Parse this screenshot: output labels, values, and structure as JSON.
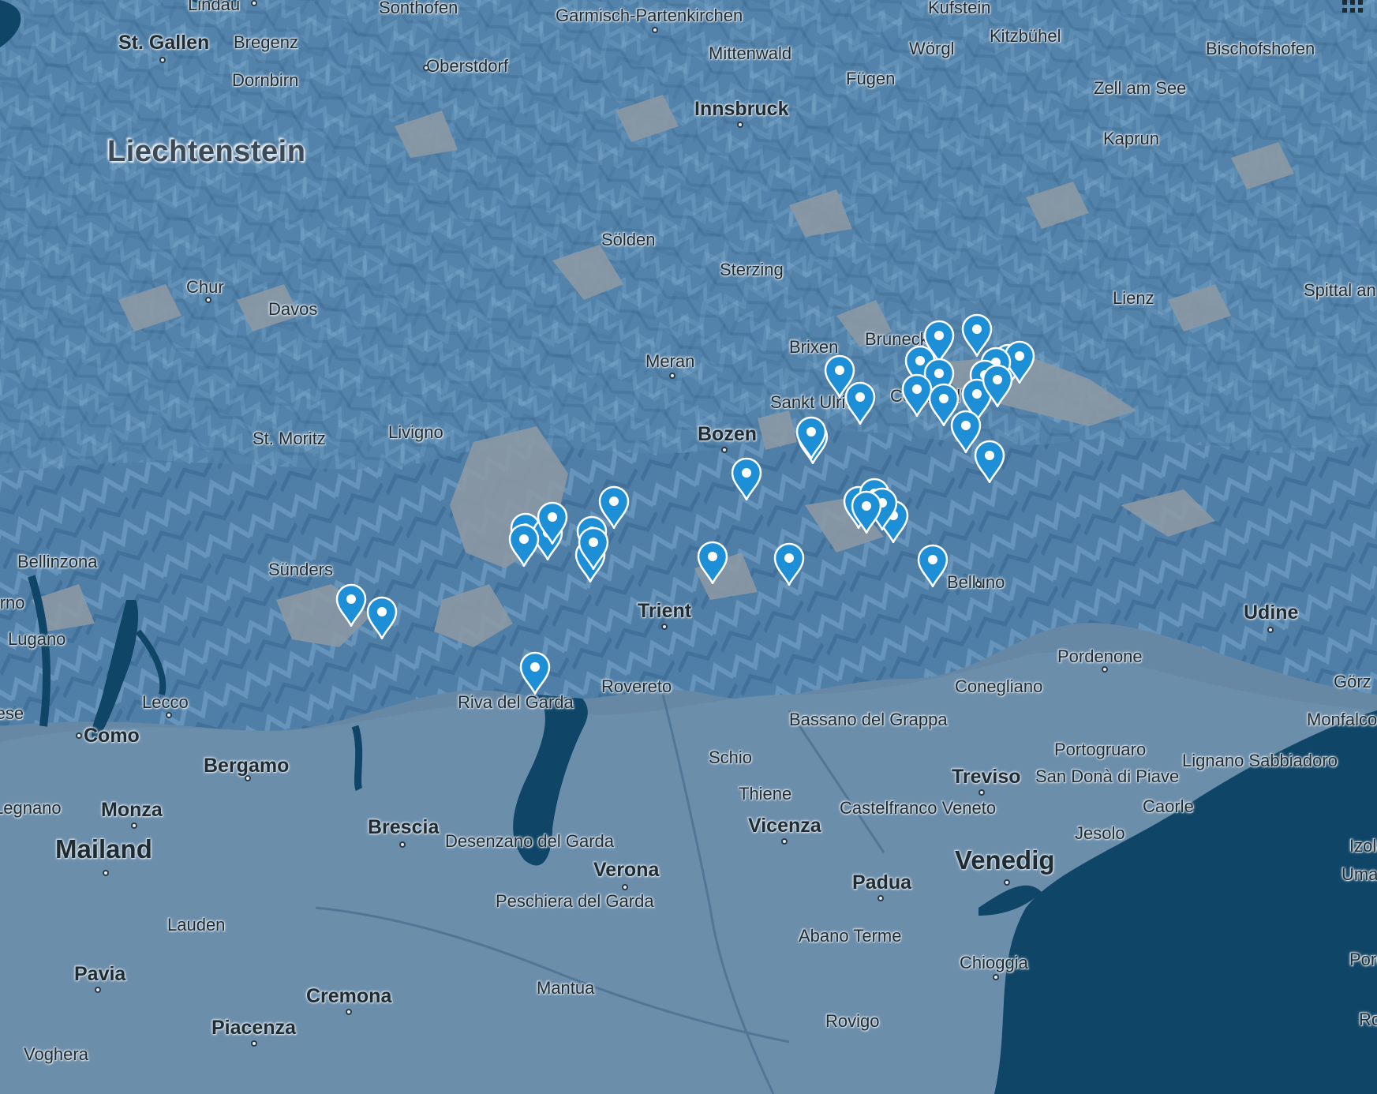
{
  "map": {
    "colors": {
      "land": "#5b82a0",
      "mountains": "#4d7ca3",
      "lowland": "#6d8fab",
      "rock": "#8e9aa5",
      "water": "#0f4566",
      "pin": "#1d8fd6"
    },
    "places": [
      {
        "name": "Lindau",
        "style": "normal"
      },
      {
        "name": "Sonthofen",
        "style": "normal"
      },
      {
        "name": "Garmisch-Partenkirchen",
        "style": "normal"
      },
      {
        "name": "Kufstein",
        "style": "normal"
      },
      {
        "name": "St. Gallen",
        "style": "big"
      },
      {
        "name": "Bregenz",
        "style": "normal"
      },
      {
        "name": "Oberstdorf",
        "style": "normal"
      },
      {
        "name": "Mittenwald",
        "style": "normal"
      },
      {
        "name": "Wörgl",
        "style": "normal"
      },
      {
        "name": "Kitzbühel",
        "style": "normal"
      },
      {
        "name": "Bischofshofen",
        "style": "normal"
      },
      {
        "name": "Dornbirn",
        "style": "normal"
      },
      {
        "name": "Fügen",
        "style": "normal"
      },
      {
        "name": "Zell am See",
        "style": "normal"
      },
      {
        "name": "Innsbruck",
        "style": "big"
      },
      {
        "name": "Kaprun",
        "style": "normal"
      },
      {
        "name": "Liechtenstein",
        "style": "country"
      },
      {
        "name": "Sölden",
        "style": "normal"
      },
      {
        "name": "Sterzing",
        "style": "normal"
      },
      {
        "name": "Chur",
        "style": "normal"
      },
      {
        "name": "Davos",
        "style": "normal"
      },
      {
        "name": "Lienz",
        "style": "normal"
      },
      {
        "name": "Spittal an der Drau",
        "style": "two"
      },
      {
        "name": "Brixen",
        "style": "normal"
      },
      {
        "name": "Bruneck",
        "style": "normal"
      },
      {
        "name": "Meran",
        "style": "normal"
      },
      {
        "name": "Sankt Ulrich",
        "style": "normal"
      },
      {
        "name": "Cortina d'Ampezzo",
        "style": "normal"
      },
      {
        "name": "Bozen",
        "style": "big"
      },
      {
        "name": "St. Moritz",
        "style": "normal"
      },
      {
        "name": "Livigno",
        "style": "normal"
      },
      {
        "name": "Bellinzona",
        "style": "normal"
      },
      {
        "name": "Sünders",
        "style": "normal"
      },
      {
        "name": "Locarno",
        "style": "normal"
      },
      {
        "name": "Belluno",
        "style": "normal"
      },
      {
        "name": "Trient",
        "style": "big"
      },
      {
        "name": "Udine",
        "style": "big"
      },
      {
        "name": "Lugano",
        "style": "normal"
      },
      {
        "name": "Pordenone",
        "style": "normal"
      },
      {
        "name": "Riva del Garda",
        "style": "normal"
      },
      {
        "name": "Rovereto",
        "style": "normal"
      },
      {
        "name": "Conegliano",
        "style": "normal"
      },
      {
        "name": "Görz",
        "style": "normal"
      },
      {
        "name": "Varese",
        "style": "normal"
      },
      {
        "name": "Lecco",
        "style": "normal"
      },
      {
        "name": "Bassano del Grappa",
        "style": "two"
      },
      {
        "name": "Monfalcone",
        "style": "normal"
      },
      {
        "name": "Como",
        "style": "big"
      },
      {
        "name": "Schio",
        "style": "normal"
      },
      {
        "name": "Portogruaro",
        "style": "normal"
      },
      {
        "name": "Lignano Sabbiadoro",
        "style": "two"
      },
      {
        "name": "Bergamo",
        "style": "big"
      },
      {
        "name": "Thiene",
        "style": "normal"
      },
      {
        "name": "Treviso",
        "style": "big"
      },
      {
        "name": "San Donà di Piave",
        "style": "two"
      },
      {
        "name": "Legnano",
        "style": "normal"
      },
      {
        "name": "Monza",
        "style": "big"
      },
      {
        "name": "Castelfranco Veneto",
        "style": "two"
      },
      {
        "name": "Caorle",
        "style": "normal"
      },
      {
        "name": "Vicenza",
        "style": "big"
      },
      {
        "name": "Brescia",
        "style": "big"
      },
      {
        "name": "Jesolo",
        "style": "normal"
      },
      {
        "name": "Izola",
        "style": "normal"
      },
      {
        "name": "Desenzano del Garda",
        "style": "two"
      },
      {
        "name": "Mailand",
        "style": "xl"
      },
      {
        "name": "Venedig",
        "style": "xl"
      },
      {
        "name": "Umag",
        "style": "normal"
      },
      {
        "name": "Verona",
        "style": "big"
      },
      {
        "name": "Padua",
        "style": "big"
      },
      {
        "name": "Peschiera del Garda",
        "style": "two"
      },
      {
        "name": "Lauden",
        "style": "normal"
      },
      {
        "name": "Abano Terme",
        "style": "normal"
      },
      {
        "name": "Pavia",
        "style": "big"
      },
      {
        "name": "Chioggia",
        "style": "normal"
      },
      {
        "name": "Poreč",
        "style": "normal"
      },
      {
        "name": "Mantua",
        "style": "normal"
      },
      {
        "name": "Cremona",
        "style": "big"
      },
      {
        "name": "Piacenza",
        "style": "big"
      },
      {
        "name": "Rovigo",
        "style": "normal"
      },
      {
        "name": "Rovinj",
        "style": "normal"
      },
      {
        "name": "Voghera",
        "style": "normal"
      },
      {
        "name": "Chur",
        "style": "normal"
      }
    ]
  }
}
